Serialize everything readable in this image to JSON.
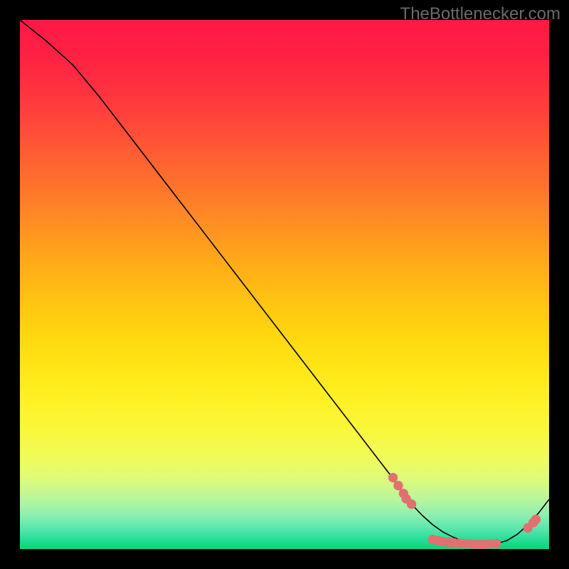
{
  "watermark": "TheBottlenecker.com",
  "chart_data": {
    "type": "line",
    "title": "",
    "xlabel": "",
    "ylabel": "",
    "xlim": [
      0,
      100
    ],
    "ylim": [
      0,
      100
    ],
    "series": [
      {
        "name": "curve",
        "x": [
          0,
          5,
          10,
          15,
          20,
          25,
          30,
          35,
          40,
          45,
          50,
          55,
          60,
          65,
          70,
          72,
          74,
          76,
          78,
          80,
          82,
          84,
          86,
          88,
          90,
          92,
          94,
          96,
          98,
          100
        ],
        "values": [
          100,
          96,
          91.5,
          85.5,
          79,
          72.5,
          66,
          59.5,
          53,
          46.5,
          40,
          33.5,
          27,
          20.5,
          14,
          11,
          8.5,
          6.4,
          4.6,
          3.2,
          2.2,
          1.4,
          1.0,
          0.9,
          1.0,
          1.6,
          2.8,
          4.6,
          6.8,
          9.4
        ]
      }
    ],
    "markers": [
      {
        "x": 70.5,
        "y": 13.5
      },
      {
        "x": 71.5,
        "y": 12.0
      },
      {
        "x": 72.5,
        "y": 10.5
      },
      {
        "x": 73.0,
        "y": 9.5
      },
      {
        "x": 74.0,
        "y": 8.5
      },
      {
        "x": 78.0,
        "y": 1.8
      },
      {
        "x": 79.0,
        "y": 1.6
      },
      {
        "x": 80.0,
        "y": 1.4
      },
      {
        "x": 81.0,
        "y": 1.3
      },
      {
        "x": 82.0,
        "y": 1.2
      },
      {
        "x": 83.0,
        "y": 1.1
      },
      {
        "x": 84.0,
        "y": 1.0
      },
      {
        "x": 85.0,
        "y": 1.0
      },
      {
        "x": 86.0,
        "y": 0.9
      },
      {
        "x": 87.0,
        "y": 0.9
      },
      {
        "x": 88.0,
        "y": 0.9
      },
      {
        "x": 89.0,
        "y": 1.0
      },
      {
        "x": 90.0,
        "y": 1.0
      },
      {
        "x": 96.0,
        "y": 4.0
      },
      {
        "x": 97.0,
        "y": 5.0
      },
      {
        "x": 97.5,
        "y": 5.6
      }
    ],
    "gradient_bands": [
      {
        "pos": 0.0,
        "color": "#ff1846"
      },
      {
        "pos": 0.06,
        "color": "#ff1f44"
      },
      {
        "pos": 0.12,
        "color": "#ff2f40"
      },
      {
        "pos": 0.18,
        "color": "#ff423b"
      },
      {
        "pos": 0.24,
        "color": "#ff5835"
      },
      {
        "pos": 0.3,
        "color": "#ff6e2e"
      },
      {
        "pos": 0.36,
        "color": "#ff8526"
      },
      {
        "pos": 0.42,
        "color": "#ff9c1e"
      },
      {
        "pos": 0.48,
        "color": "#ffb216"
      },
      {
        "pos": 0.54,
        "color": "#ffc611"
      },
      {
        "pos": 0.6,
        "color": "#ffd810"
      },
      {
        "pos": 0.66,
        "color": "#ffe617"
      },
      {
        "pos": 0.72,
        "color": "#fff126"
      },
      {
        "pos": 0.78,
        "color": "#f8f83d"
      },
      {
        "pos": 0.82,
        "color": "#f2fb55"
      },
      {
        "pos": 0.86,
        "color": "#e2fb74"
      },
      {
        "pos": 0.89,
        "color": "#c9f890"
      },
      {
        "pos": 0.915,
        "color": "#acf4a3"
      },
      {
        "pos": 0.935,
        "color": "#8defae"
      },
      {
        "pos": 0.95,
        "color": "#70eab0"
      },
      {
        "pos": 0.962,
        "color": "#56e6ac"
      },
      {
        "pos": 0.972,
        "color": "#3fe2a3"
      },
      {
        "pos": 0.98,
        "color": "#2cde99"
      },
      {
        "pos": 0.987,
        "color": "#1cdb8d"
      },
      {
        "pos": 0.993,
        "color": "#10d982"
      },
      {
        "pos": 1.0,
        "color": "#07d778"
      }
    ],
    "marker_color": "#e27070",
    "line_color": "#000000"
  }
}
